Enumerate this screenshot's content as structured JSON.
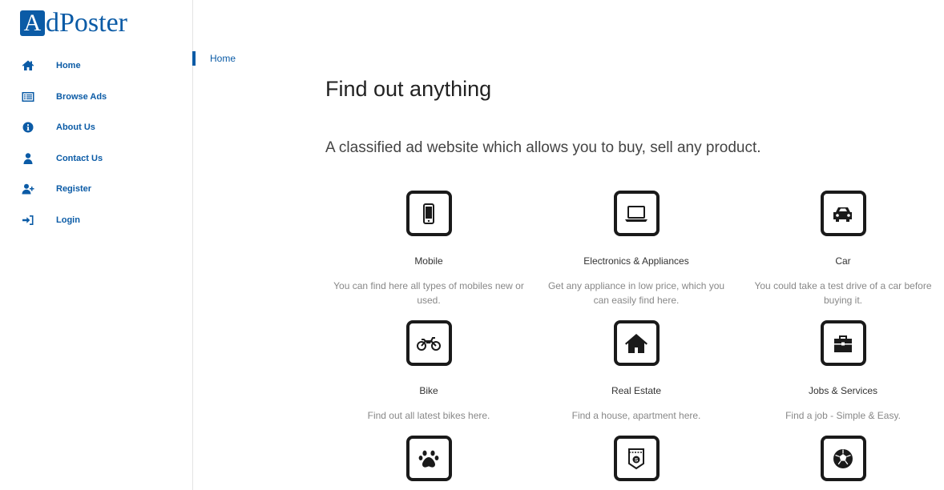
{
  "brand": {
    "logo_letter": "A",
    "logo_rest": "dPoster",
    "accent": "#0b5ba6"
  },
  "sidebar": {
    "items": [
      {
        "label": "Home",
        "icon": "home-icon"
      },
      {
        "label": "Browse Ads",
        "icon": "list-icon"
      },
      {
        "label": "About Us",
        "icon": "info-icon"
      },
      {
        "label": "Contact Us",
        "icon": "user-icon"
      },
      {
        "label": "Register",
        "icon": "user-plus-icon"
      },
      {
        "label": "Login",
        "icon": "sign-in-icon"
      }
    ]
  },
  "breadcrumb": {
    "current": "Home"
  },
  "main": {
    "heading": "Find out anything",
    "subheading": "A classified ad website which allows you to buy, sell any product.",
    "categories": [
      {
        "title": "Mobile",
        "desc": "You can find here all types of mobiles new or used.",
        "icon": "mobile-icon"
      },
      {
        "title": "Electronics & Appliances",
        "desc": "Get any appliance in low price, which you can easily find here.",
        "icon": "laptop-icon"
      },
      {
        "title": "Car",
        "desc": "You could take a test drive of a car before buying it.",
        "icon": "car-icon"
      },
      {
        "title": "Bike",
        "desc": "Find out all latest bikes here.",
        "icon": "motorcycle-icon"
      },
      {
        "title": "Real Estate",
        "desc": "Find a house, apartment here.",
        "icon": "house-icon"
      },
      {
        "title": "Jobs & Services",
        "desc": "Find a job - Simple & Easy.",
        "icon": "briefcase-icon"
      },
      {
        "title": "",
        "desc": "",
        "icon": "paw-icon"
      },
      {
        "title": "",
        "desc": "",
        "icon": "jeans-pocket-icon"
      },
      {
        "title": "",
        "desc": "",
        "icon": "soccer-ball-icon"
      }
    ]
  }
}
